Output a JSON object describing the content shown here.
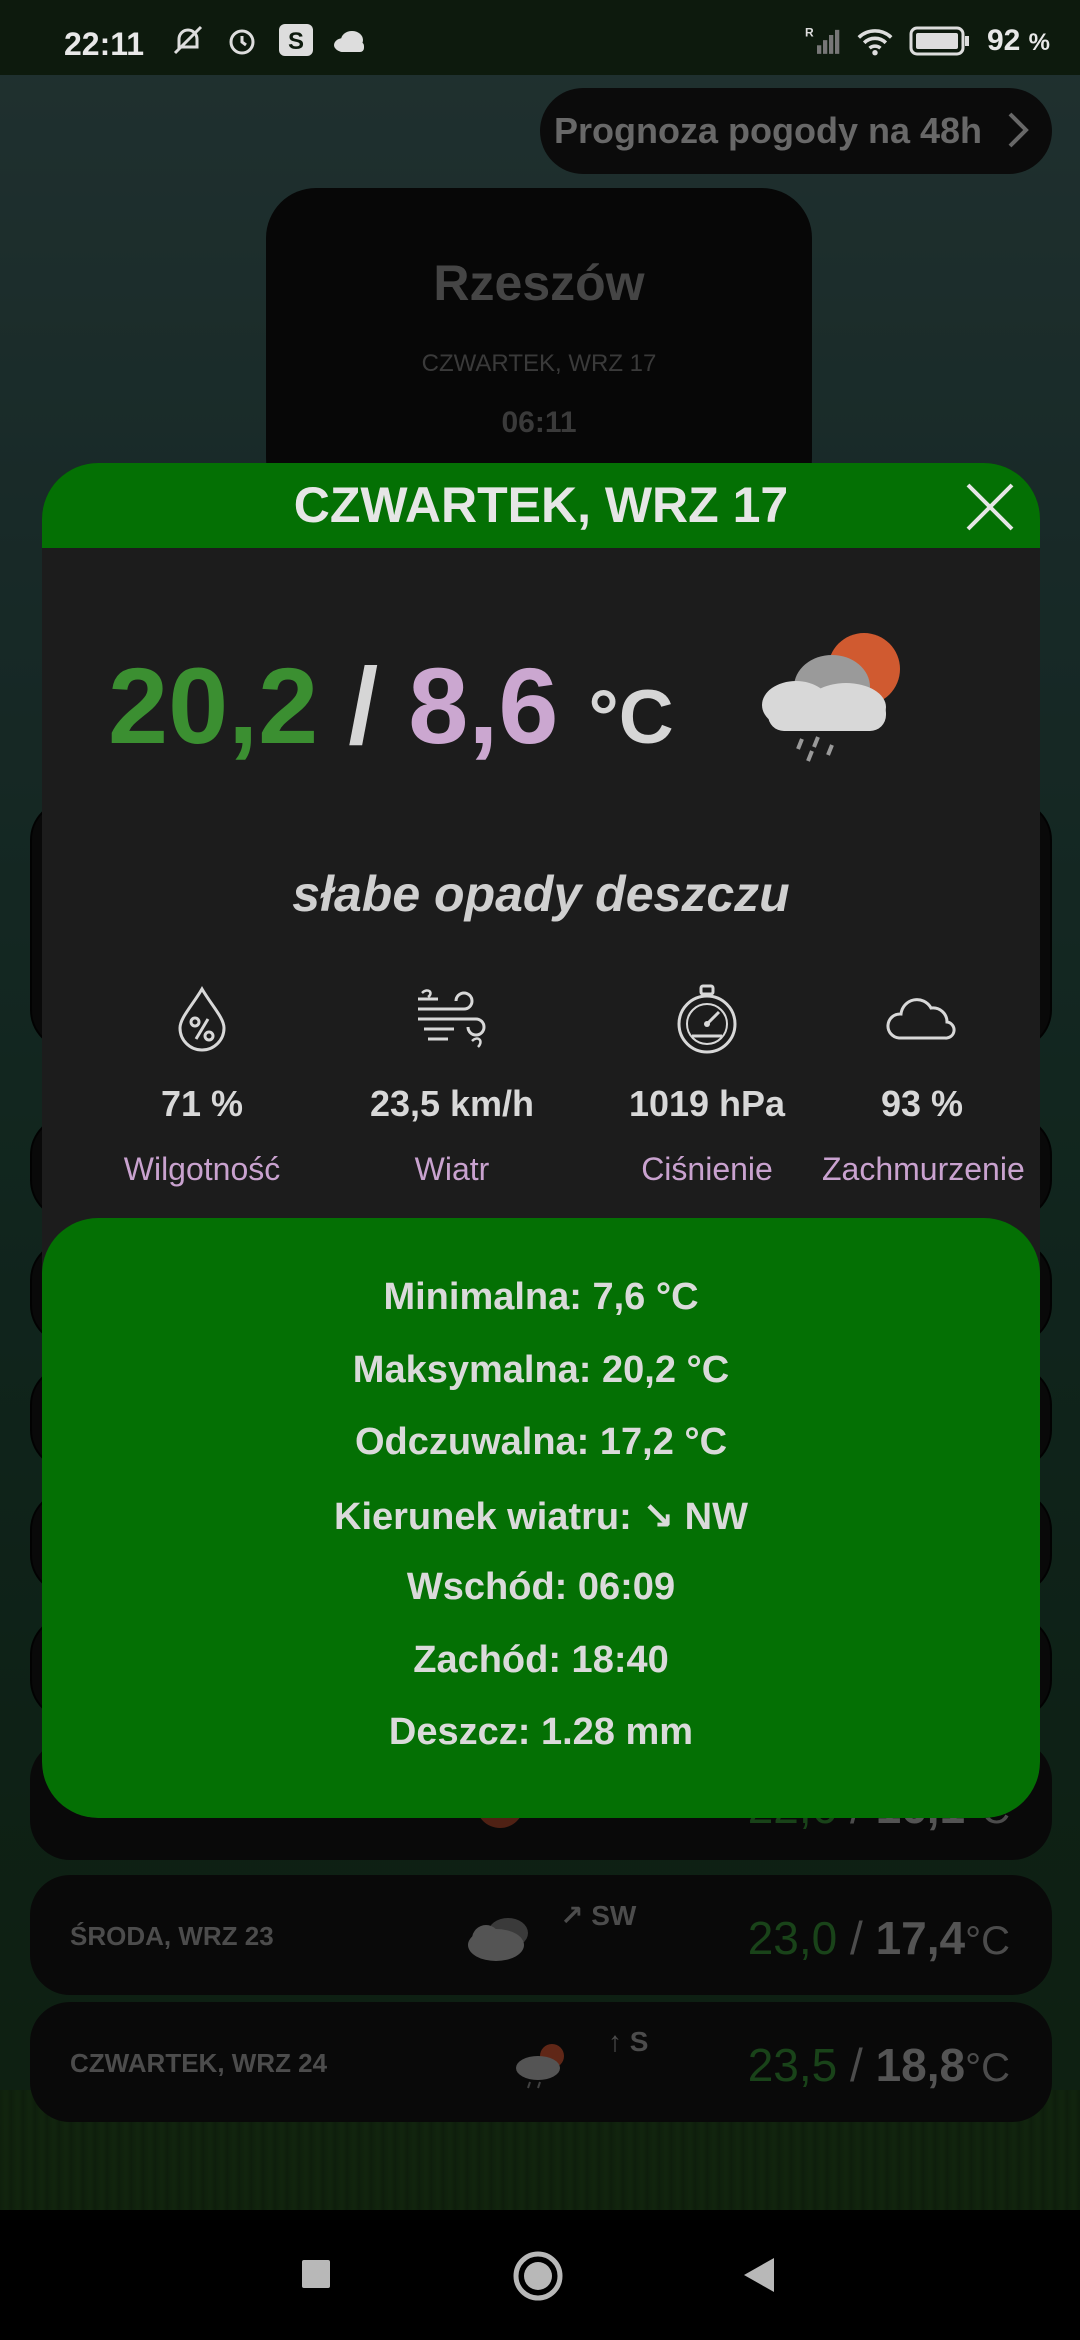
{
  "status_bar": {
    "time": "22:11",
    "battery": "92",
    "battery_unit": "%",
    "signal_label": "R"
  },
  "top_button": {
    "label": "Prognoza pogody na 48h"
  },
  "city_card": {
    "city": "Rzeszów",
    "date": "CZWARTEK, WRZ 17",
    "time_partial": "06:11"
  },
  "dialog": {
    "title": "CZWARTEK, WRZ 17",
    "temp_max": "20,2",
    "separator": "/",
    "temp_min": "8,6",
    "unit": "°C",
    "description": "słabe opady deszczu",
    "stats": [
      {
        "icon": "humidity-icon",
        "value": "71 %",
        "label": "Wilgotność"
      },
      {
        "icon": "wind-icon",
        "value": "23,5 km/h",
        "label": "Wiatr"
      },
      {
        "icon": "pressure-gauge-icon",
        "value": "1019 hPa",
        "label": "Ciśnienie"
      },
      {
        "icon": "cloud-icon",
        "value": "93 %",
        "label": "Zachmurzenie"
      }
    ],
    "details": [
      "Minimalna: 7,6 °C",
      "Maksymalna: 20,2 °C",
      "Odczuwalna: 17,2 °C",
      "Kierunek wiatru: ↘ NW",
      "Wschód: 06:09",
      "Zachód: 18:40",
      "Deszcz: 1.28 mm"
    ]
  },
  "forecast_rows": [
    {
      "day": "",
      "wind": "",
      "max": "22,6",
      "min": "16,1",
      "unit": "°C"
    },
    {
      "day": "ŚRODA, WRZ 23",
      "wind": "↗ SW",
      "max": "23,0",
      "min": "17,4",
      "unit": "°C"
    },
    {
      "day": "CZWARTEK, WRZ 24",
      "wind": "↑ S",
      "max": "23,5",
      "min": "18,8",
      "unit": "°C"
    }
  ],
  "colors": {
    "accent_green": "#047004",
    "max_temp": "#3b8f31",
    "min_temp": "#cba7d0",
    "label_purple": "#c9a2cf",
    "sun_orange": "#d05a30"
  }
}
